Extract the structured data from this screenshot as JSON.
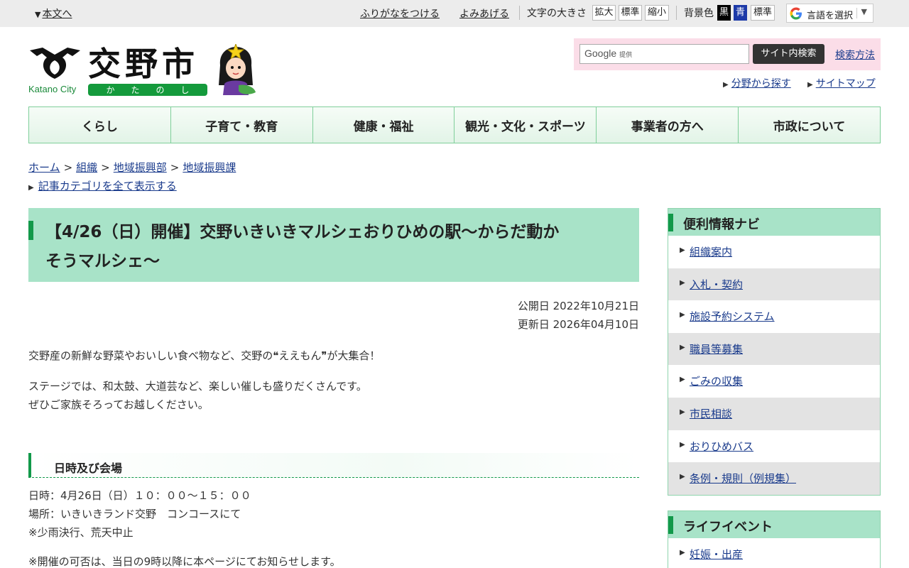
{
  "utility": {
    "skip_link": "本文へ",
    "furigana": "ふりがなをつける",
    "read_aloud": "よみあげる",
    "font_size_label": "文字の大きさ",
    "font_larger": "拡大",
    "font_standard": "標準",
    "font_smaller": "縮小",
    "bg_color_label": "背景色",
    "bg_black": "黒",
    "bg_blue": "青",
    "bg_standard": "標準",
    "translate": "言語を選択"
  },
  "header": {
    "city_name": "交野市",
    "city_name_en": "Katano City",
    "city_name_kana": [
      "か",
      "た",
      "の",
      "し"
    ],
    "search_provider": "Google",
    "search_provider_note": "提供",
    "search_button": "サイト内検索",
    "search_help": "検索方法",
    "browse_by_field": "分野から探す",
    "sitemap": "サイトマップ"
  },
  "nav": [
    "くらし",
    "子育て・教育",
    "健康・福祉",
    "観光・文化・スポーツ",
    "事業者の方へ",
    "市政について"
  ],
  "breadcrumb": [
    "ホーム",
    "組織",
    "地域振興部",
    "地域振興課"
  ],
  "breadcrumb_sep": ">",
  "show_all_categories": "記事カテゴリを全て表示する",
  "article": {
    "title_line1": "【4/26（日）開催】交野いきいきマルシェおりひめの駅〜からだ動か",
    "title_line2": "そうマルシェ〜",
    "published": "公開日 2022年10月21日",
    "updated": "更新日 2026年04月10日",
    "intro": "交野産の新鮮な野菜やおいしい食べ物など、交野の❝ええもん❞が大集合！",
    "stage_line1": "ステージでは、和太鼓、大道芸など、楽しい催しも盛りだくさんです。",
    "stage_line2": "ぜひご家族そろってお越しください。",
    "section_heading": "日時及び会場",
    "datetime": "日時：4月26日（日）１０：００〜１５：００",
    "venue": "場所：いきいきランド交野　コンコースにて",
    "rain_note": "※少雨決行、荒天中止",
    "notice": "※開催の可否は、当日の9時以降に本ページにてお知らせします。"
  },
  "sidebar": {
    "nav_title": "便利情報ナビ",
    "nav_items": [
      "組織案内",
      "入札・契約",
      "施設予約システム",
      "職員等募集",
      "ごみの収集",
      "市民相談",
      "おりひめバス",
      "条例・規則（例規集）"
    ],
    "life_title": "ライフイベント",
    "life_items": [
      "妊娠・出産"
    ]
  },
  "colors": {
    "accent_green": "#12994a",
    "title_bg": "#a8e3c8",
    "link": "#1a3b8c",
    "search_bg": "#fbdde8"
  }
}
